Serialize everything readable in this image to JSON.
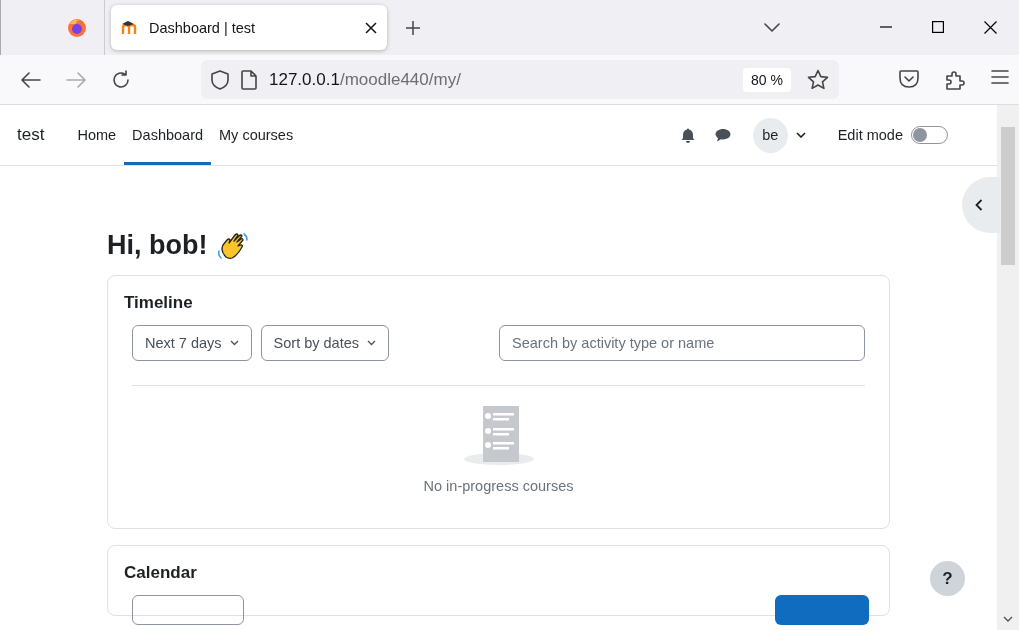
{
  "browser": {
    "tab": {
      "title": "Dashboard | test",
      "selected": true
    },
    "address": {
      "host": "127.0.0.1",
      "path": "/moodle440/my/"
    },
    "zoom": "80 %"
  },
  "navbar": {
    "site_name": "test",
    "items": [
      {
        "label": "Home",
        "selected": false
      },
      {
        "label": "Dashboard",
        "selected": true
      },
      {
        "label": "My courses",
        "selected": false
      }
    ],
    "avatar": "be",
    "edit_mode": {
      "label": "Edit mode",
      "on": false
    }
  },
  "greeting": "Hi, bob!",
  "timeline": {
    "title": "Timeline",
    "filters": [
      "Next 7 days",
      "Sort by dates"
    ],
    "search": {
      "placeholder": "Search by activity type or name"
    },
    "empty_message": "No in-progress courses"
  },
  "calendar": {
    "title": "Calendar"
  },
  "help_button": "?"
}
